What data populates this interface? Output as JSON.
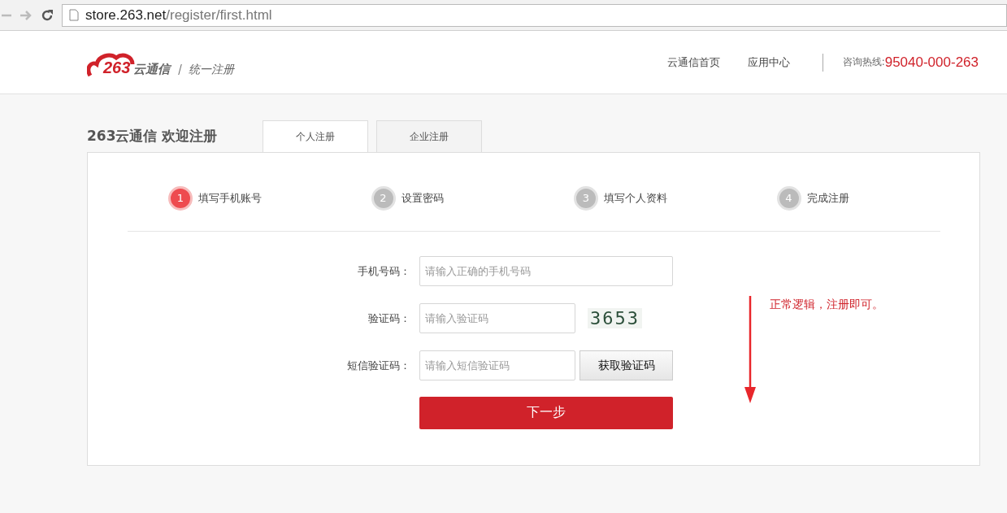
{
  "browser": {
    "url_host": "store.263.net",
    "url_path": "/register/first.html"
  },
  "header": {
    "logo": {
      "number": "263",
      "name": "云通信"
    },
    "subtitle": "统一注册",
    "nav": [
      "云通信首页",
      "应用中心"
    ],
    "hotline_label": "咨询热线:",
    "hotline": "95040-000-263"
  },
  "page_title": "263云通信 欢迎注册",
  "tabs": [
    {
      "label": "个人注册",
      "selected": true
    },
    {
      "label": "企业注册",
      "selected": false
    }
  ],
  "steps": [
    {
      "number": "1",
      "label": "填写手机账号",
      "selected": true
    },
    {
      "number": "2",
      "label": "设置密码",
      "selected": false
    },
    {
      "number": "3",
      "label": "填写个人资料",
      "selected": false
    },
    {
      "number": "4",
      "label": "完成注册",
      "selected": false
    }
  ],
  "form": {
    "rows": [
      {
        "kind": "input",
        "label": "手机号码：",
        "placeholder": "请输入正确的手机号码"
      },
      {
        "kind": "captcha",
        "label": "验证码：",
        "placeholder": "请输入验证码",
        "captcha": "3653"
      },
      {
        "kind": "sms",
        "label": "短信验证码：",
        "placeholder": "请输入短信验证码",
        "button": "获取验证码"
      }
    ],
    "submit": "下一步"
  },
  "annotation": "正常逻辑，注册即可。"
}
